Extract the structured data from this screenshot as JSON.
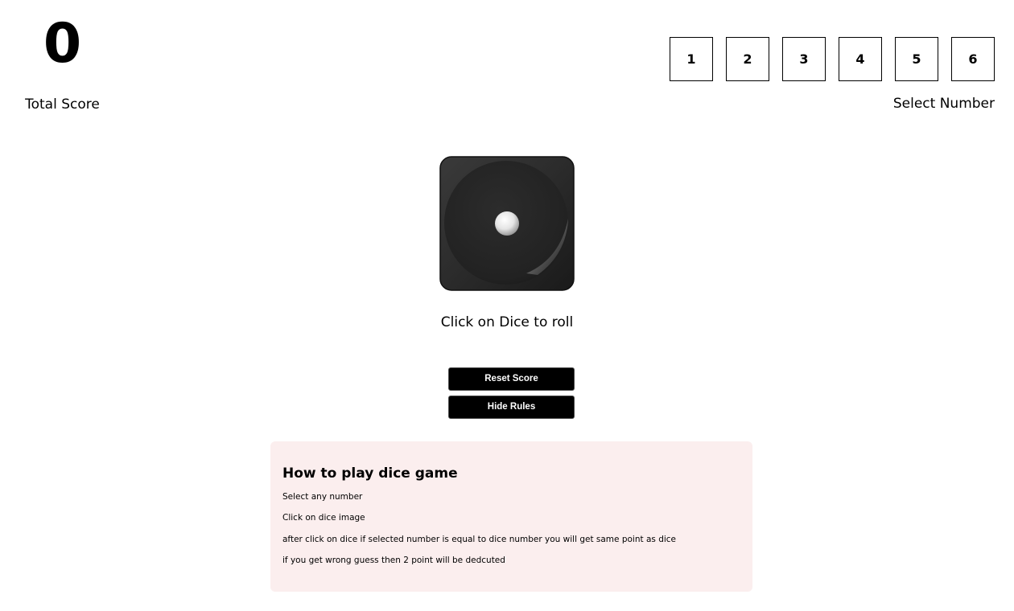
{
  "score": {
    "value": "0",
    "label": "Total Score"
  },
  "selector": {
    "numbers": [
      "1",
      "2",
      "3",
      "4",
      "5",
      "6"
    ],
    "label": "Select Number"
  },
  "dice": {
    "current_face": 1,
    "icon": "dice-face-1-icon",
    "caption": "Click on Dice to roll"
  },
  "buttons": {
    "reset": "Reset Score",
    "hide_rules": "Hide Rules"
  },
  "rules": {
    "title": "How to play dice game",
    "items": [
      "Select any number",
      "Click on dice image",
      "after click on dice if selected number is equal to dice number you will get same point as dice",
      "if you get wrong guess then 2 point will be dedcuted"
    ]
  },
  "colors": {
    "rules_background": "#fbeeee",
    "button_background": "#000000",
    "dice_body": "#2b2b2b"
  }
}
